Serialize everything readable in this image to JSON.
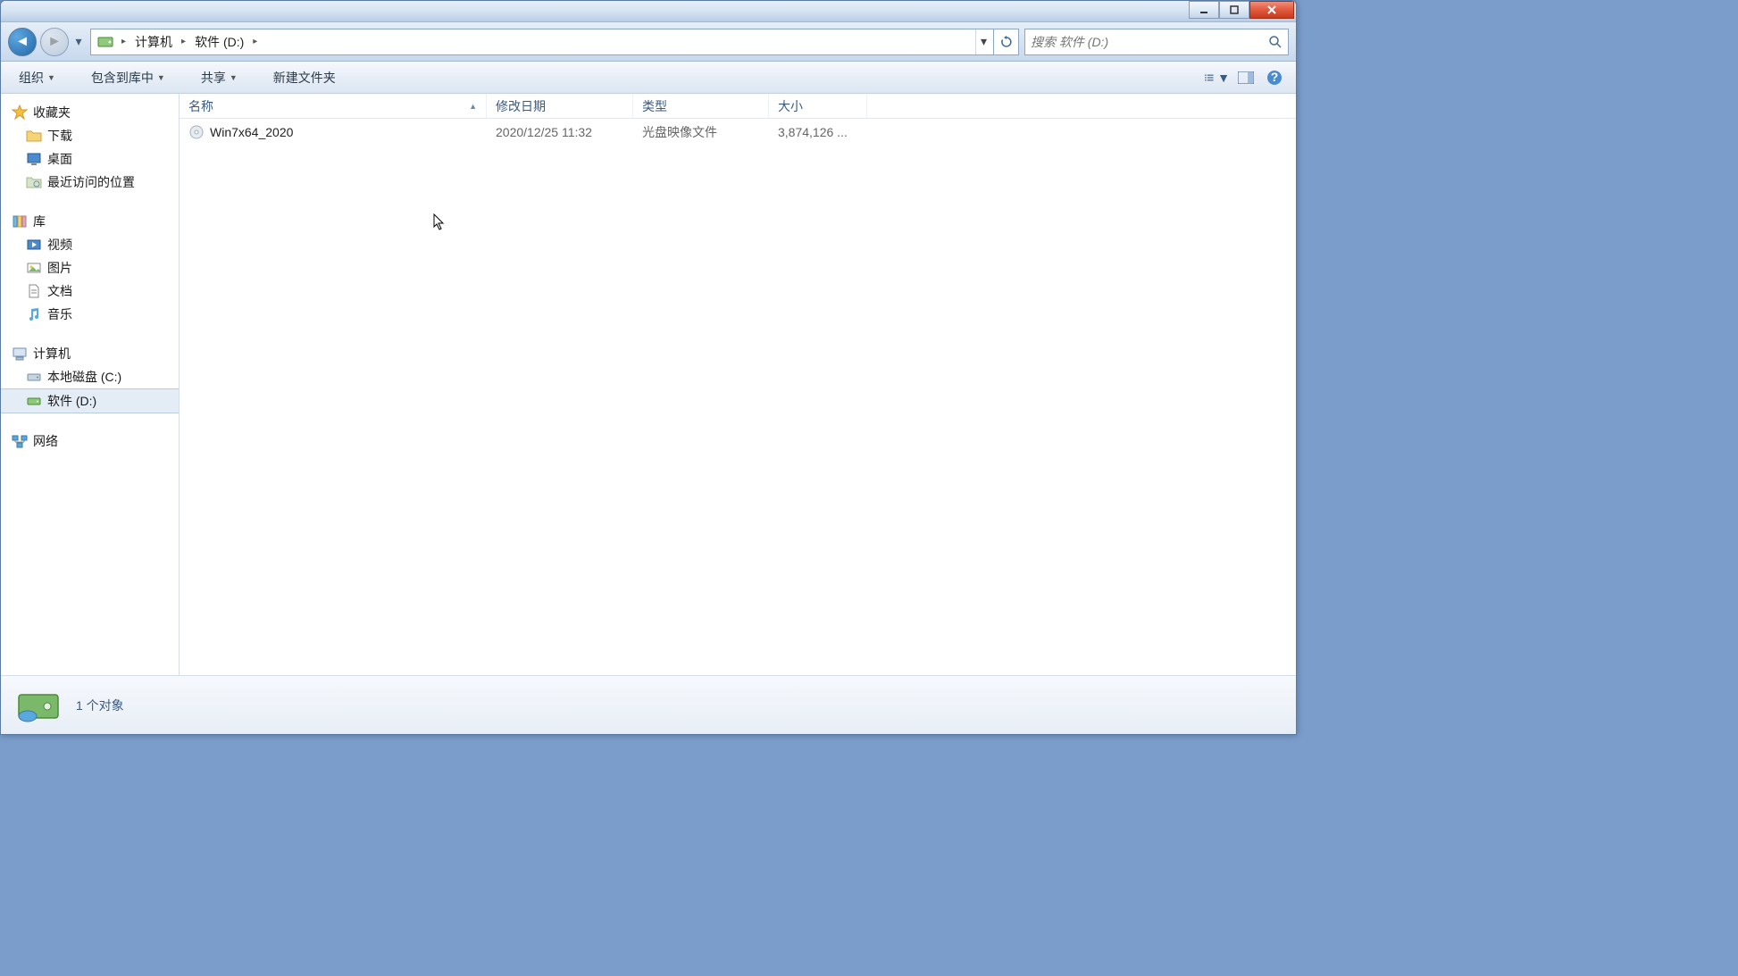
{
  "breadcrumb": {
    "segments": [
      "计算机",
      "软件 (D:)"
    ]
  },
  "search": {
    "placeholder": "搜索 软件 (D:)"
  },
  "toolbar": {
    "organize": "组织",
    "include": "包含到库中",
    "share": "共享",
    "newfolder": "新建文件夹"
  },
  "columns": {
    "name": "名称",
    "date": "修改日期",
    "type": "类型",
    "size": "大小"
  },
  "files": [
    {
      "name": "Win7x64_2020",
      "date": "2020/12/25 11:32",
      "type": "光盘映像文件",
      "size": "3,874,126 ..."
    }
  ],
  "sidebar": {
    "favorites": {
      "label": "收藏夹",
      "items": [
        "下载",
        "桌面",
        "最近访问的位置"
      ]
    },
    "libraries": {
      "label": "库",
      "items": [
        "视频",
        "图片",
        "文档",
        "音乐"
      ]
    },
    "computer": {
      "label": "计算机",
      "items": [
        "本地磁盘 (C:)",
        "软件 (D:)"
      ]
    },
    "network": {
      "label": "网络"
    }
  },
  "status": {
    "text": "1 个对象"
  }
}
